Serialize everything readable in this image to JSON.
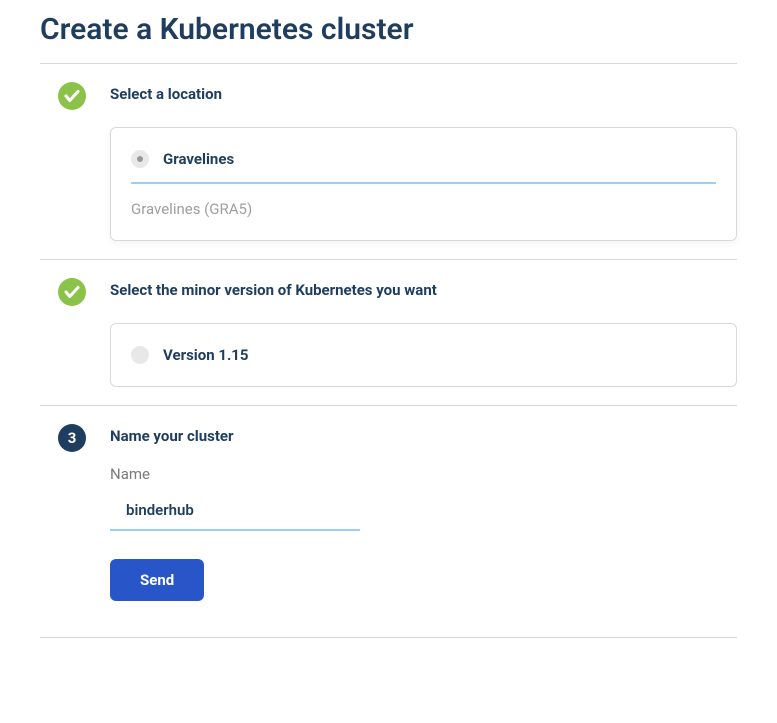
{
  "page": {
    "title": "Create a Kubernetes cluster"
  },
  "steps": {
    "location": {
      "title": "Select a location",
      "option_label": "Gravelines",
      "selected_detail": "Gravelines (GRA5)"
    },
    "version": {
      "title": "Select the minor version of Kubernetes you want",
      "option_label": "Version 1.15"
    },
    "name": {
      "number": "3",
      "title": "Name your cluster",
      "field_label": "Name",
      "value": "binderhub",
      "button_label": "Send"
    }
  }
}
